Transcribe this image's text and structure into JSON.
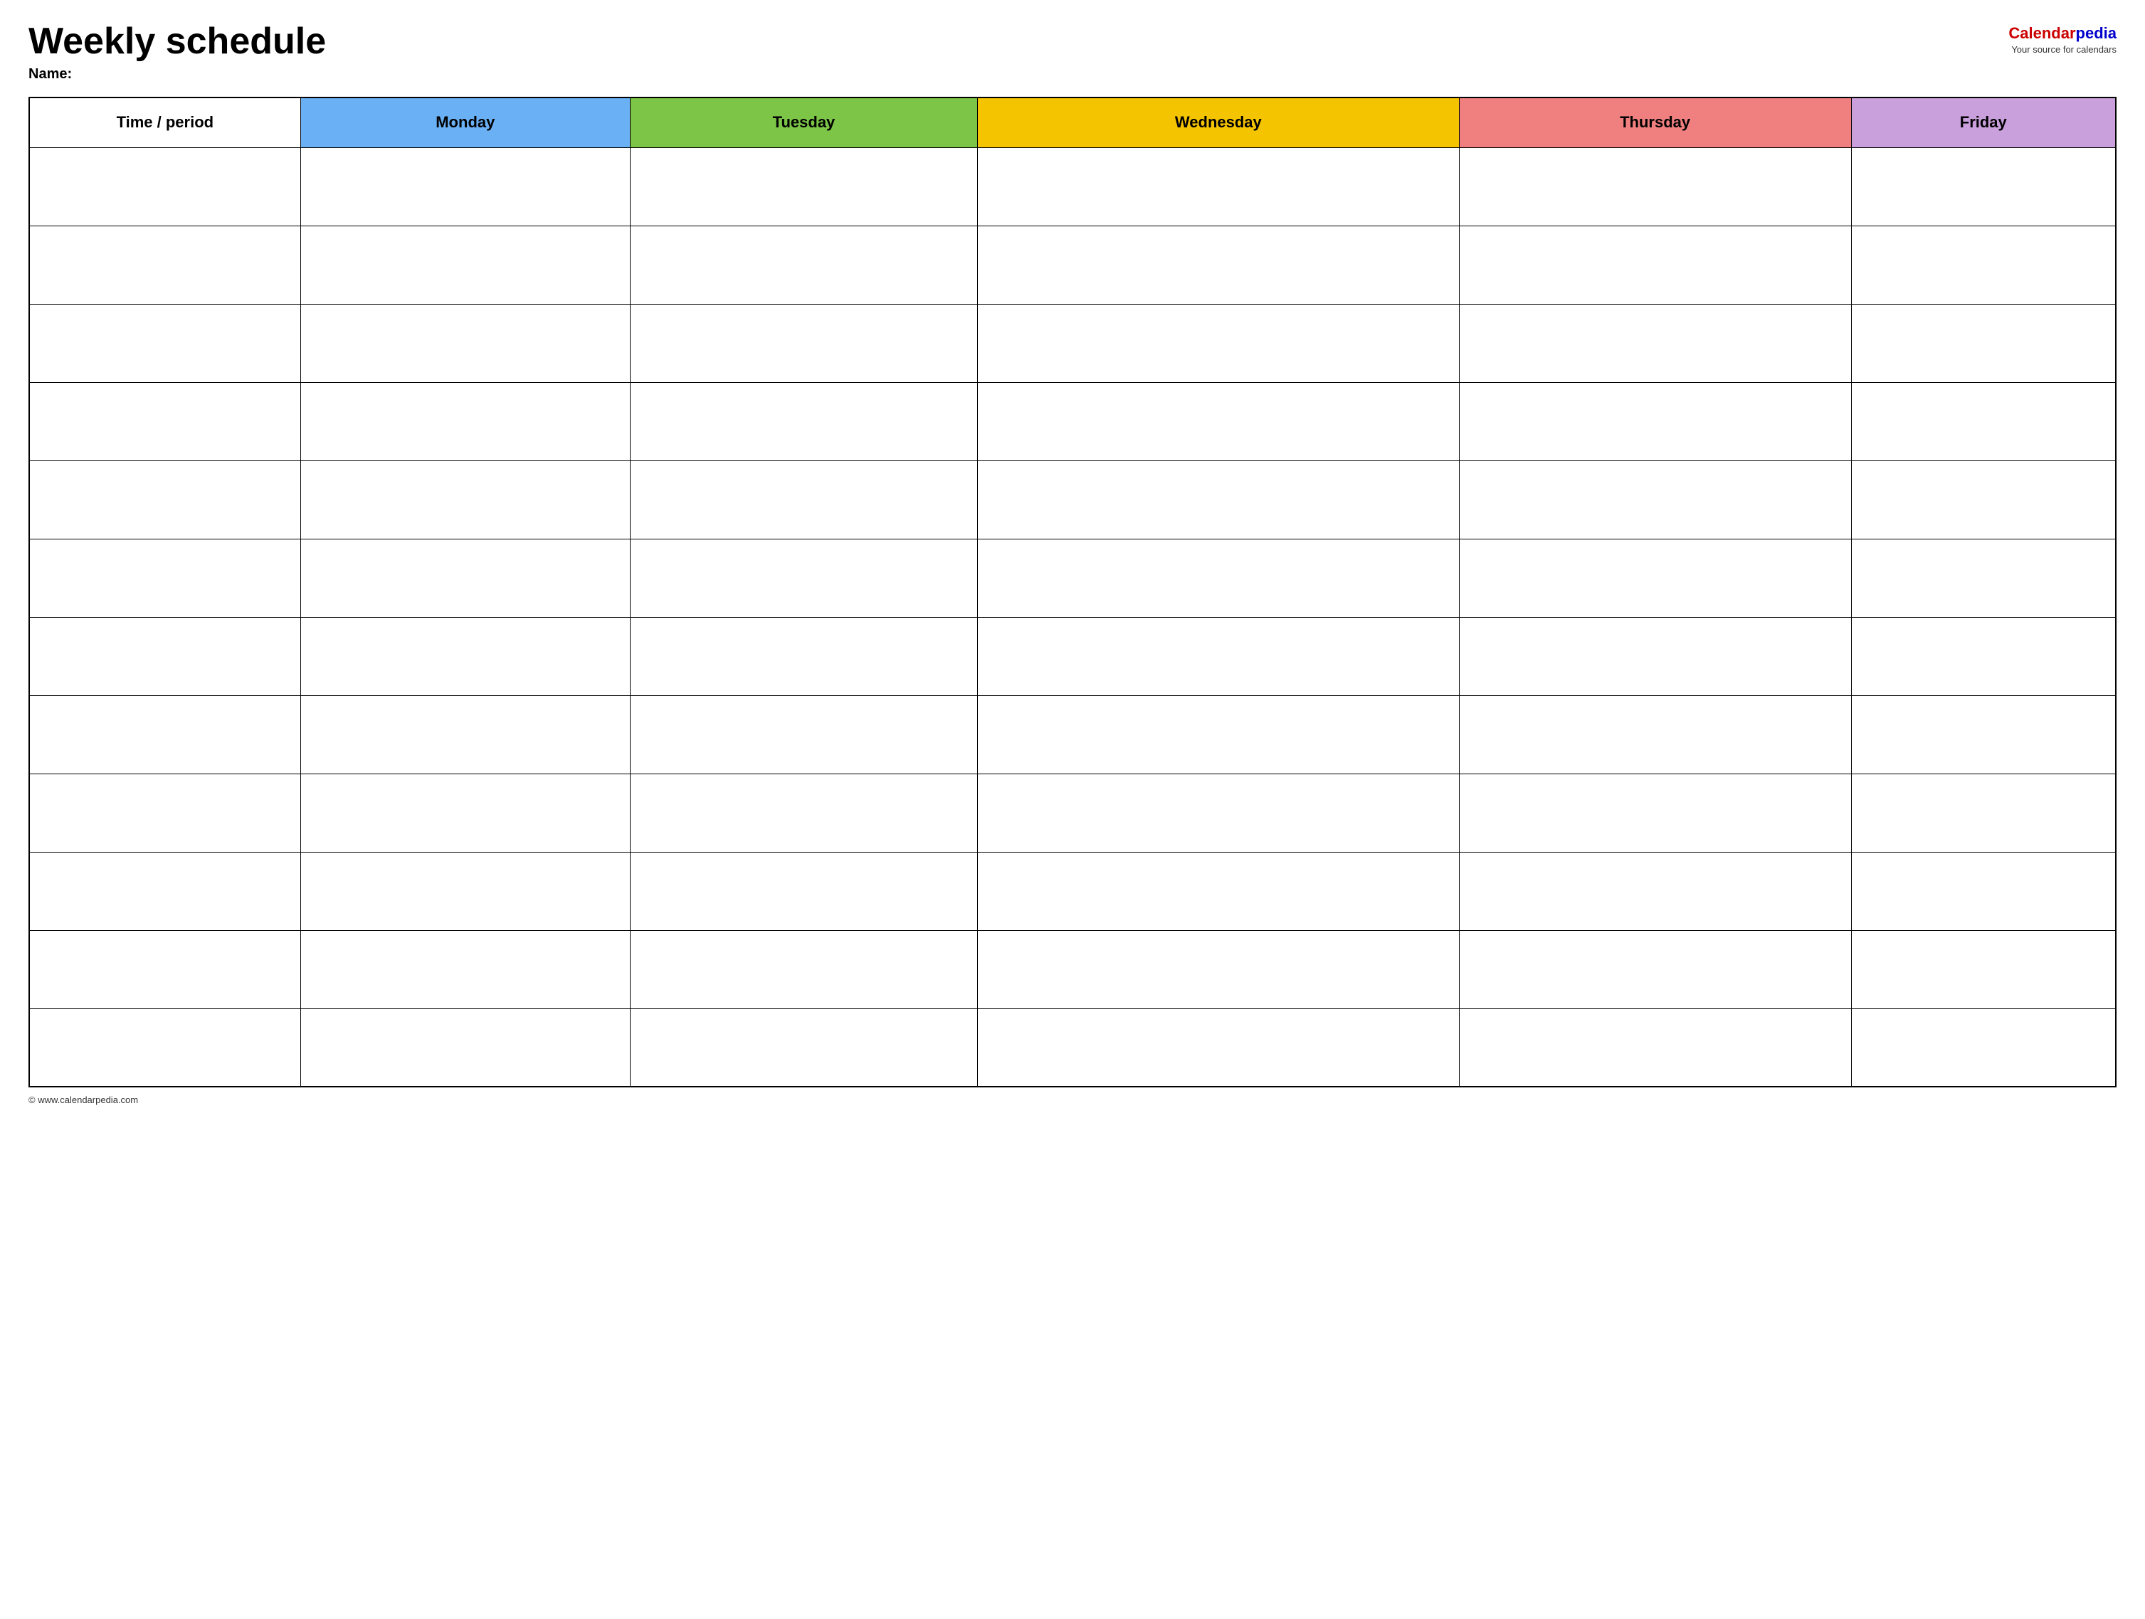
{
  "header": {
    "title": "Weekly schedule",
    "name_label": "Name:",
    "logo": {
      "calendar_text": "Calendar",
      "pedia_text": "pedia",
      "tagline": "Your source for calendars"
    }
  },
  "table": {
    "columns": [
      {
        "id": "time",
        "label": "Time / period",
        "color": "#ffffff"
      },
      {
        "id": "monday",
        "label": "Monday",
        "color": "#6ab0f5"
      },
      {
        "id": "tuesday",
        "label": "Tuesday",
        "color": "#7cc547"
      },
      {
        "id": "wednesday",
        "label": "Wednesday",
        "color": "#f5c400"
      },
      {
        "id": "thursday",
        "label": "Thursday",
        "color": "#f08080"
      },
      {
        "id": "friday",
        "label": "Friday",
        "color": "#c9a0dc"
      }
    ],
    "rows": 12
  },
  "footer": {
    "copyright": "© www.calendarpedia.com"
  }
}
